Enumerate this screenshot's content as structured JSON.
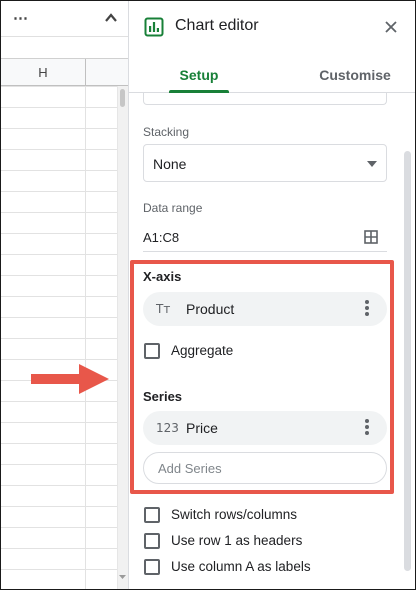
{
  "sheet": {
    "more_label": "⋯",
    "column_header": "H"
  },
  "panel": {
    "title": "Chart editor",
    "tabs": [
      {
        "label": "Setup",
        "active": true
      },
      {
        "label": "Customise",
        "active": false
      }
    ],
    "stacking": {
      "label": "Stacking",
      "value": "None"
    },
    "data_range": {
      "label": "Data range",
      "value": "A1:C8"
    },
    "x_axis": {
      "label": "X-axis",
      "item_icon": "Tт",
      "item_label": "Product"
    },
    "aggregate_label": "Aggregate",
    "series": {
      "label": "Series",
      "item_icon": "123",
      "item_label": "Price",
      "add_label": "Add Series"
    },
    "options": [
      {
        "label": "Switch rows/columns"
      },
      {
        "label": "Use row 1 as headers"
      },
      {
        "label": "Use column A as labels"
      }
    ]
  },
  "colors": {
    "accent": "#188038",
    "highlight": "#e8574a"
  },
  "icons": {
    "panel": "chart-icon",
    "close": "close-icon",
    "range": "grid-icon",
    "menu": "kebab-menu-icon"
  }
}
